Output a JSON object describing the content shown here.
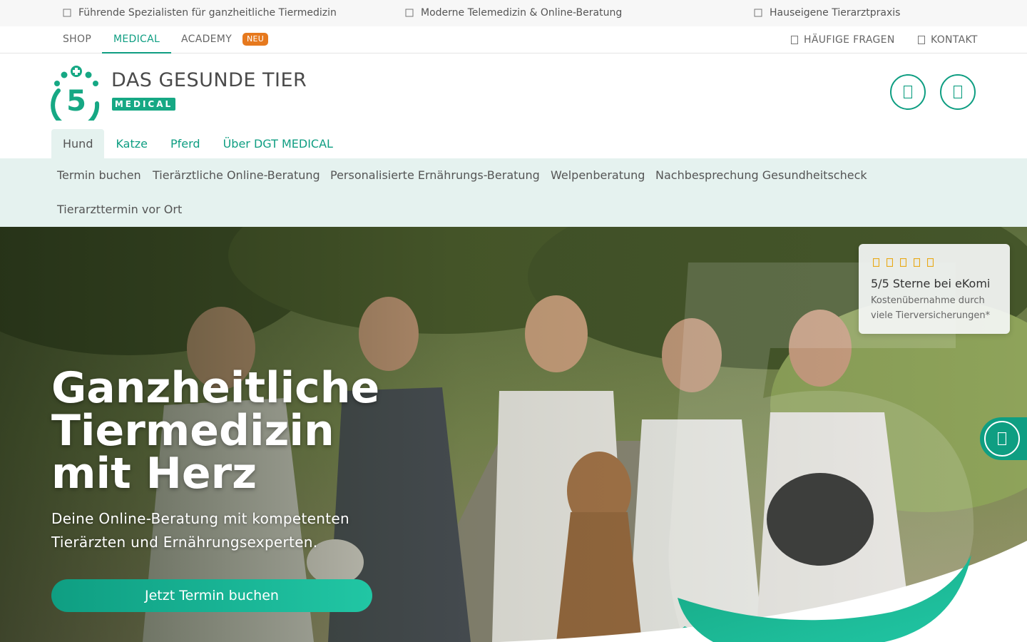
{
  "topbar": {
    "usps": [
      {
        "icon": "check-icon",
        "text": "Führende Spezialisten für ganzheitliche Tiermedizin"
      },
      {
        "icon": "check-icon",
        "text": "Moderne Telemedizin & Online-Beratung"
      },
      {
        "icon": "check-icon",
        "text": "Hauseigene Tierarztpraxis"
      }
    ]
  },
  "secondary_nav": {
    "shop": "SHOP",
    "medical": "MEDICAL",
    "academy": "ACADEMY",
    "academy_badge": "NEU",
    "faq": "HÄUFIGE FRAGEN",
    "contact": "KONTAKT"
  },
  "header": {
    "brand_name": "DAS GESUNDE TIER",
    "brand_sub": "MEDICAL",
    "logo_number": "5",
    "icons": [
      "user-icon",
      "cart-icon"
    ]
  },
  "species_tabs": [
    {
      "label": "Hund",
      "active": true
    },
    {
      "label": "Katze",
      "active": false
    },
    {
      "label": "Pferd",
      "active": false
    },
    {
      "label": "Über DGT MEDICAL",
      "active": false
    }
  ],
  "submenu": [
    "Termin buchen",
    "Tierärztliche Online-Beratung",
    "Personalisierte Ernährungs-Beratung",
    "Welpenberatung",
    "Nachbesprechung Gesundheitscheck",
    "Tierarzttermin vor Ort"
  ],
  "hero": {
    "title_lines": [
      "Ganzheitliche",
      "Tiermedizin",
      "mit Herz"
    ],
    "subtitle_lines": [
      "Deine Online-Beratung mit kompetenten",
      "Tierärzten und Ernährungsexperten."
    ],
    "cta": "Jetzt Termin buchen"
  },
  "rating": {
    "stars": 5,
    "title": "5/5 Sterne bei eKomi",
    "subtitle_lines": [
      "Kostenübernahme durch",
      "viele Tierversicherungen*"
    ]
  },
  "side_button": {
    "icon": "chat-icon"
  },
  "colors": {
    "accent": "#0f9e82",
    "accent_light": "#21c6a4",
    "badge": "#e6791e",
    "submenu_bg": "#e5f2ef",
    "star": "#e8a917"
  }
}
